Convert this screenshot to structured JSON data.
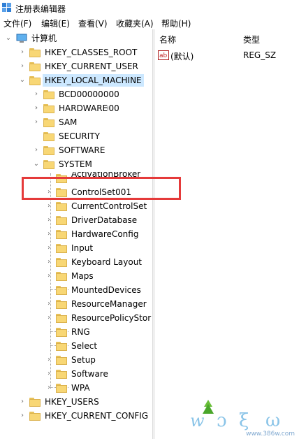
{
  "window": {
    "title": "注册表编辑器"
  },
  "menu": [
    "文件(F)",
    "编辑(E)",
    "查看(V)",
    "收藏夹(A)",
    "帮助(H)"
  ],
  "tree": {
    "root": "计算机",
    "hives": {
      "classes_root": "HKEY_CLASSES_ROOT",
      "current_user": "HKEY_CURRENT_USER",
      "local_machine": "HKEY_LOCAL_MACHINE",
      "users": "HKEY_USERS",
      "current_config": "HKEY_CURRENT_CONFIG"
    },
    "hklm_children": [
      "BCD00000000",
      "HARDWARE",
      "SAM",
      "SECURITY",
      "SOFTWARE",
      "SYSTEM"
    ],
    "system_children": [
      "ActivationBroker",
      "ControlSet001",
      "CurrentControlSet",
      "DriverDatabase",
      "HardwareConfig",
      "Input",
      "Keyboard Layout",
      "Maps",
      "MountedDevices",
      "ResourceManager",
      "ResourcePolicyStor",
      "RNG",
      "Select",
      "Setup",
      "Software",
      "WPA"
    ]
  },
  "list": {
    "headers": {
      "name": "名称",
      "type": "类型"
    },
    "rows": [
      {
        "name": "(默认)",
        "type": "REG_SZ",
        "icon": "ab-string-icon"
      }
    ]
  },
  "watermark": {
    "text": "www.386w.com",
    "icon": "xitongcheng-logo"
  },
  "colors": {
    "highlight": "#e53a3a",
    "selection": "#cce8ff",
    "folder": "#f8d775"
  }
}
